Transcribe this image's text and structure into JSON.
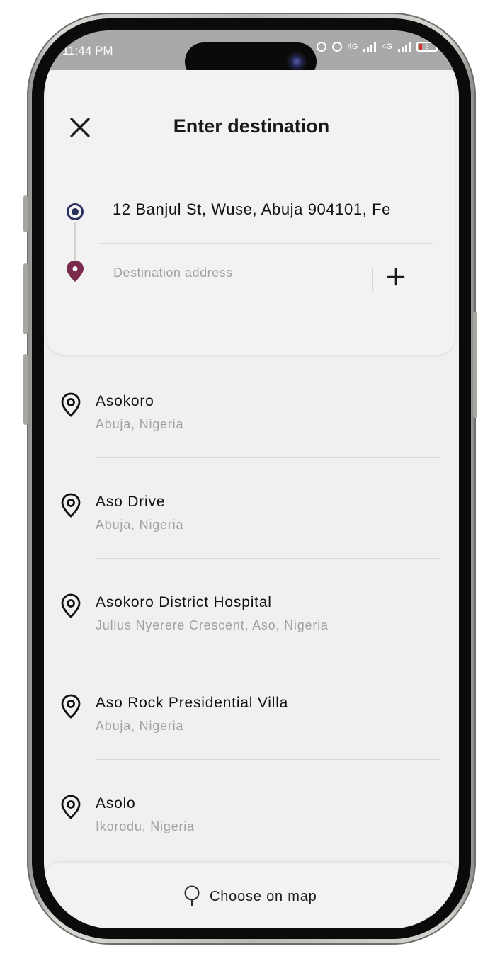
{
  "status_bar": {
    "time": "11:44 PM",
    "network_1": "4G",
    "network_2": "4G",
    "battery_level": "5"
  },
  "header": {
    "title": "Enter destination"
  },
  "route": {
    "origin_address": "12 Banjul St, Wuse, Abuja 904101, Fe",
    "destination_placeholder": "Destination address",
    "destination_value": ""
  },
  "suggestions": [
    {
      "title": "Asokoro",
      "subtitle": "Abuja, Nigeria"
    },
    {
      "title": "Aso Drive",
      "subtitle": "Abuja, Nigeria"
    },
    {
      "title": "Asokoro District Hospital",
      "subtitle": "Julius Nyerere Crescent, Aso, Nigeria"
    },
    {
      "title": "Aso Rock Presidential Villa",
      "subtitle": "Abuja, Nigeria"
    },
    {
      "title": "Asolo",
      "subtitle": "Ikorodu, Nigeria"
    }
  ],
  "footer": {
    "choose_on_map": "Choose on map"
  },
  "icons": {
    "close": "close-icon",
    "origin": "origin-dot-icon",
    "destination": "destination-pin-icon",
    "add_stop": "plus-icon",
    "suggestion": "location-pin-icon",
    "map": "map-pin-outline-icon"
  },
  "colors": {
    "origin_dot": "#2b2f5e",
    "destination_pin": "#7a2a4a",
    "screen_bg": "#f0f0f0",
    "status_bar_bg": "#a9a9a9"
  }
}
